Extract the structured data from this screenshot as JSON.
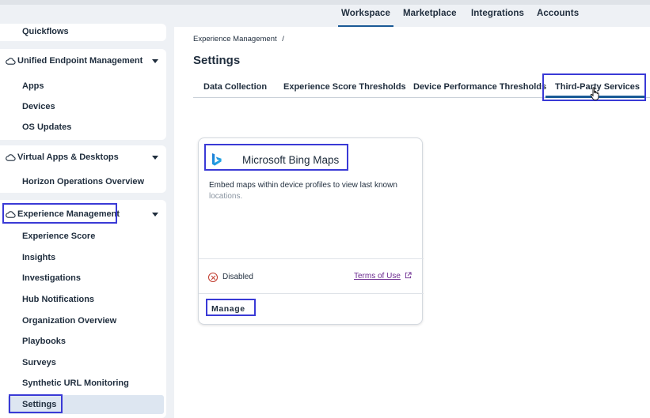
{
  "topnav": {
    "tabs": [
      {
        "label": "Workspace",
        "active": true
      },
      {
        "label": "Marketplace",
        "active": false
      },
      {
        "label": "Integrations",
        "active": false
      },
      {
        "label": "Accounts",
        "active": false
      }
    ]
  },
  "sidebar": {
    "top_item": "Quickflows",
    "groups": [
      {
        "label": "Unified Endpoint Management",
        "icon": "cloud-icon",
        "items": [
          "Apps",
          "Devices",
          "OS Updates"
        ]
      },
      {
        "label": "Virtual Apps & Desktops",
        "icon": "cloud-icon",
        "items": [
          "Horizon Operations Overview"
        ]
      },
      {
        "label": "Experience Management",
        "icon": "cloud-icon",
        "items": [
          "Experience Score",
          "Insights",
          "Investigations",
          "Hub Notifications",
          "Organization Overview",
          "Playbooks",
          "Surveys",
          "Synthetic URL Monitoring",
          "Settings"
        ],
        "selected_item": "Settings"
      }
    ]
  },
  "main": {
    "breadcrumb": "Experience Management",
    "breadcrumb_sep": "/",
    "title": "Settings",
    "tabs": [
      "Data Collection",
      "Experience Score Thresholds",
      "Device Performance Thresholds",
      "Third-Party Services"
    ],
    "active_tab": "Third-Party Services",
    "card": {
      "name": "Microsoft Bing Maps",
      "description_line1": "Embed maps within device profiles to view last known",
      "description_line2": "locations.",
      "status": "Disabled",
      "terms_link": "Terms of Use",
      "manage_label": "Manage",
      "logo_icon": "bing-icon"
    }
  },
  "colors": {
    "accent": "#1a5a96",
    "highlight": "#3a3ad6",
    "disabled": "#c0392b",
    "link": "#6b2a8f"
  }
}
